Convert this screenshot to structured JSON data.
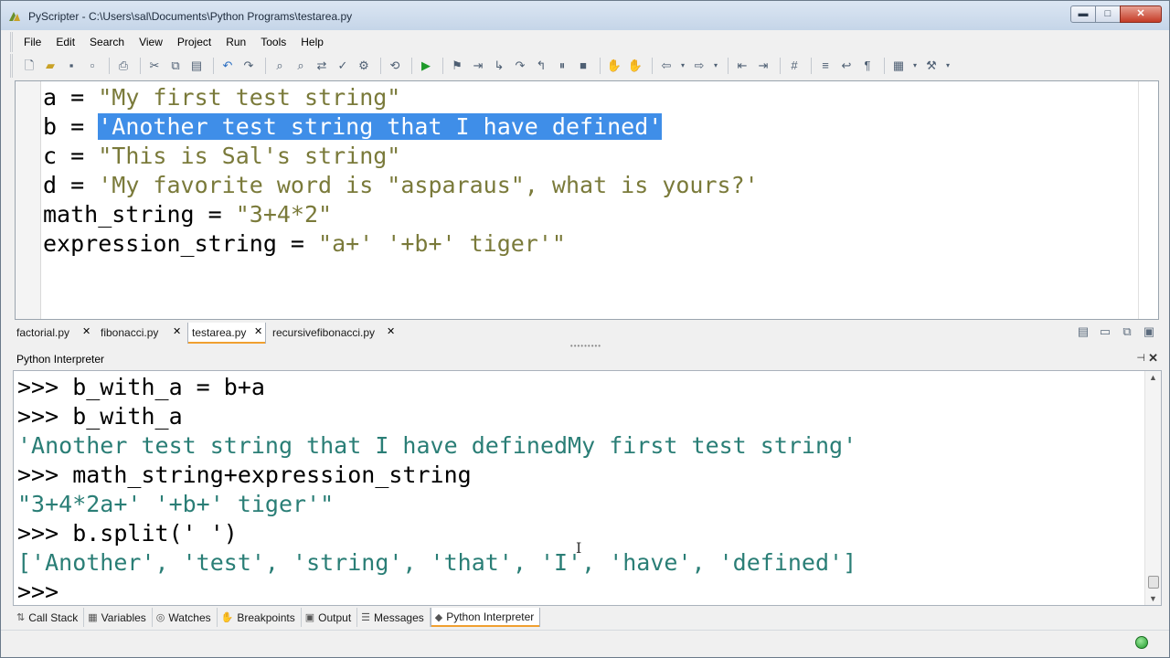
{
  "window": {
    "title": "PyScripter - C:\\Users\\sal\\Documents\\Python Programs\\testarea.py",
    "min_label": "▬",
    "max_label": "□",
    "close_label": "✕"
  },
  "menu": [
    "File",
    "Edit",
    "Search",
    "View",
    "Project",
    "Run",
    "Tools",
    "Help"
  ],
  "editor": {
    "lines": [
      {
        "pre": "a = ",
        "str": "\"My first test string\"",
        "selected": false
      },
      {
        "pre": "b = ",
        "str": "'Another test string that I have defined'",
        "selected": true
      },
      {
        "pre": "c = ",
        "str": "\"This is Sal's string\"",
        "selected": false
      },
      {
        "pre": "d = ",
        "str": "'My favorite word is \"asparaus\", what is yours?'",
        "selected": false
      },
      {
        "pre": "math_string = ",
        "str": "\"3+4*2\"",
        "selected": false
      },
      {
        "pre": "expression_string = ",
        "str": "\"a+' '+b+' tiger'\"",
        "selected": false
      }
    ]
  },
  "file_tabs": [
    {
      "label": "factorial.py",
      "active": false
    },
    {
      "label": "fibonacci.py",
      "active": false
    },
    {
      "label": "testarea.py",
      "active": true
    },
    {
      "label": "recursivefibonacci.py",
      "active": false
    }
  ],
  "file_tab_close": "✕",
  "interpreter": {
    "title": "Python Interpreter",
    "pin": "⊣",
    "close": "✕",
    "lines": [
      {
        "kind": "prompt",
        "text": ">>> b_with_a = b+a"
      },
      {
        "kind": "prompt",
        "text": ">>> b_with_a"
      },
      {
        "kind": "out",
        "text": "'Another test string that I have definedMy first test string'"
      },
      {
        "kind": "prompt",
        "text": ">>> math_string+expression_string"
      },
      {
        "kind": "out",
        "text": "\"3+4*2a+' '+b+' tiger'\""
      },
      {
        "kind": "prompt",
        "text": ">>> b.split(' ')"
      },
      {
        "kind": "out",
        "text": "['Another', 'test', 'string', 'that', 'I', 'have', 'defined']"
      },
      {
        "kind": "prompt",
        "text": ">>>"
      }
    ]
  },
  "bottom_tabs": [
    {
      "label": "Call Stack",
      "icon": "call-stack-icon",
      "glyph": "⇅",
      "active": false
    },
    {
      "label": "Variables",
      "icon": "variables-icon",
      "glyph": "▦",
      "active": false
    },
    {
      "label": "Watches",
      "icon": "watches-icon",
      "glyph": "◎",
      "active": false
    },
    {
      "label": "Breakpoints",
      "icon": "breakpoints-icon",
      "glyph": "✋",
      "active": false
    },
    {
      "label": "Output",
      "icon": "output-icon",
      "glyph": "▣",
      "active": false
    },
    {
      "label": "Messages",
      "icon": "messages-icon",
      "glyph": "☰",
      "active": false
    },
    {
      "label": "Python Interpreter",
      "icon": "python-icon",
      "glyph": "◆",
      "active": true
    }
  ],
  "colors": {
    "selection": "#3f8ee8",
    "string": "#7a7a3a",
    "output": "#2a7e76",
    "active_tab_accent": "#f0a030",
    "status_ok": "#1f9a2a"
  }
}
